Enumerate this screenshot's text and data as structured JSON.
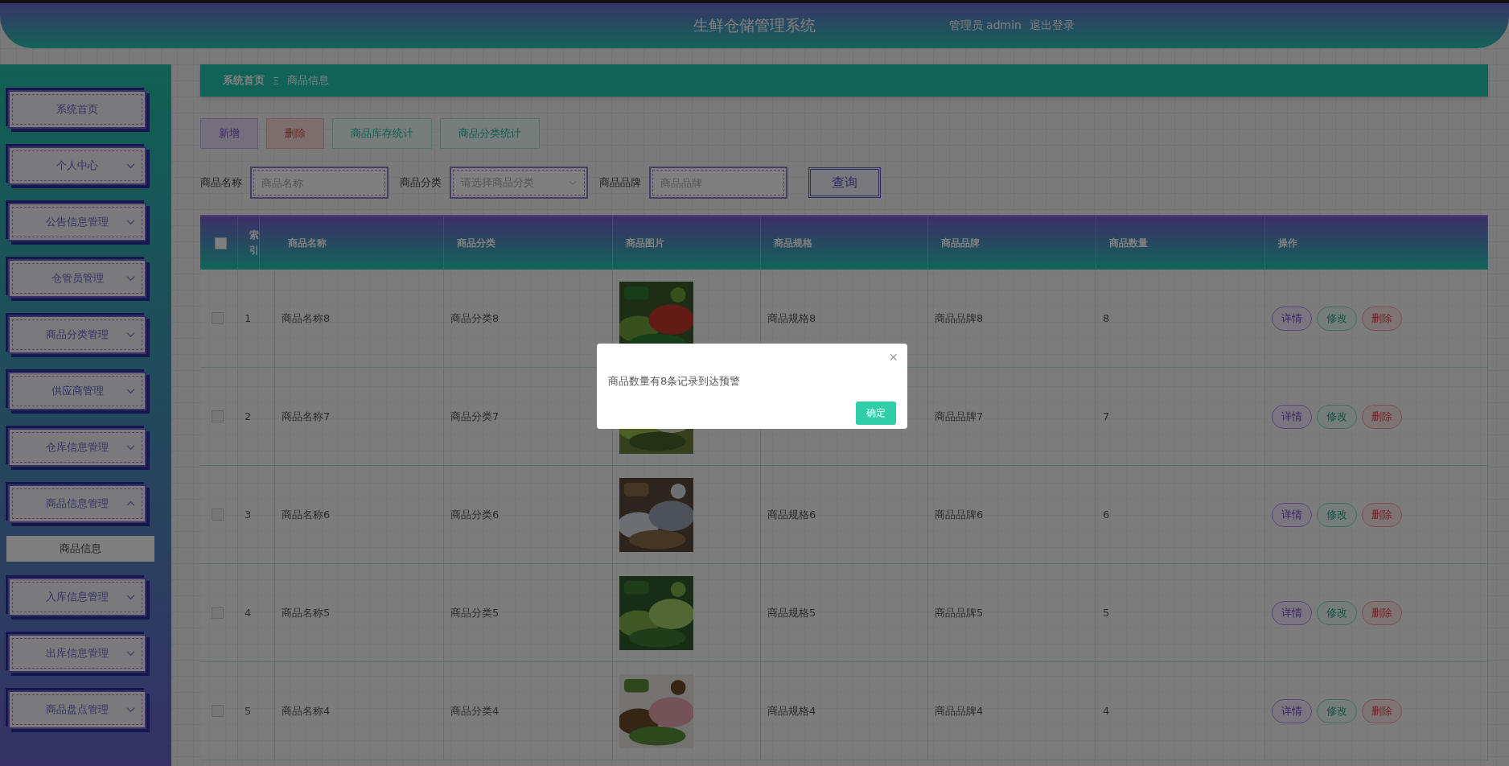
{
  "header": {
    "title": "生鲜仓储管理系统",
    "user": "管理员 admin",
    "logout": "退出登录"
  },
  "sidebar": {
    "items": [
      {
        "label": "系统首页",
        "kind": "link"
      },
      {
        "label": "个人中心",
        "kind": "group",
        "expanded": false
      },
      {
        "label": "公告信息管理",
        "kind": "group",
        "expanded": false
      },
      {
        "label": "仓管员管理",
        "kind": "group",
        "expanded": false
      },
      {
        "label": "商品分类管理",
        "kind": "group",
        "expanded": false
      },
      {
        "label": "供应商管理",
        "kind": "group",
        "expanded": false
      },
      {
        "label": "仓库信息管理",
        "kind": "group",
        "expanded": false
      },
      {
        "label": "商品信息管理",
        "kind": "group",
        "expanded": true,
        "children": [
          {
            "label": "商品信息",
            "selected": true
          }
        ]
      },
      {
        "label": "入库信息管理",
        "kind": "group",
        "expanded": false
      },
      {
        "label": "出库信息管理",
        "kind": "group",
        "expanded": false
      },
      {
        "label": "商品盘点管理",
        "kind": "group",
        "expanded": false
      }
    ]
  },
  "breadcrumb": {
    "items": [
      "系统首页",
      "商品信息"
    ],
    "separator": "Ξ"
  },
  "toolbar": [
    {
      "label": "新增",
      "kind": "add"
    },
    {
      "label": "删除",
      "kind": "delete"
    },
    {
      "label": "商品库存统计",
      "kind": "stat"
    },
    {
      "label": "商品分类统计",
      "kind": "stat"
    }
  ],
  "search": {
    "fields": [
      {
        "label": "商品名称",
        "placeholder": "商品名称",
        "kind": "input"
      },
      {
        "label": "商品分类",
        "placeholder": "请选择商品分类",
        "kind": "select"
      },
      {
        "label": "商品品牌",
        "placeholder": "商品品牌",
        "kind": "input"
      }
    ],
    "button": "查询"
  },
  "table": {
    "all_checked": false,
    "columns": [
      "索引",
      "商品名称",
      "商品分类",
      "商品图片",
      "商品规格",
      "商品品牌",
      "商品数量",
      "操作"
    ],
    "rows": [
      {
        "checked": false,
        "index": "1",
        "name": "商品名称8",
        "category": "商品分类8",
        "image": {
          "kind": "picture"
        },
        "spec": "商品规格8",
        "brand": "商品品牌8",
        "quantity": "8",
        "actions": [
          {
            "label": "详情",
            "kind": "detail"
          },
          {
            "label": "修改",
            "kind": "edit"
          },
          {
            "label": "删除",
            "kind": "delete"
          }
        ]
      },
      {
        "checked": false,
        "index": "2",
        "name": "商品名称7",
        "category": "商品分类7",
        "image": {
          "kind": "picture"
        },
        "brand": "商品品牌7",
        "quantity": "7",
        "actions": [
          {
            "label": "详情",
            "kind": "detail"
          },
          {
            "label": "修改",
            "kind": "edit"
          },
          {
            "label": "删除",
            "kind": "delete"
          }
        ]
      },
      {
        "checked": false,
        "index": "3",
        "name": "商品名称6",
        "category": "商品分类6",
        "image": {
          "kind": "picture"
        },
        "spec": "商品规格6",
        "brand": "商品品牌6",
        "quantity": "6",
        "actions": [
          {
            "label": "详情",
            "kind": "detail"
          },
          {
            "label": "修改",
            "kind": "edit"
          },
          {
            "label": "删除",
            "kind": "delete"
          }
        ]
      },
      {
        "checked": false,
        "index": "4",
        "name": "商品名称5",
        "category": "商品分类5",
        "image": {
          "kind": "picture"
        },
        "spec": "商品规格5",
        "brand": "商品品牌5",
        "quantity": "5",
        "actions": [
          {
            "label": "详情",
            "kind": "detail"
          },
          {
            "label": "修改",
            "kind": "edit"
          },
          {
            "label": "删除",
            "kind": "delete"
          }
        ]
      },
      {
        "checked": false,
        "index": "5",
        "name": "商品名称4",
        "category": "商品分类4",
        "image": {
          "kind": "picture"
        },
        "spec": "商品规格4",
        "brand": "商品品牌4",
        "quantity": "4",
        "actions": [
          {
            "label": "详情",
            "kind": "detail"
          },
          {
            "label": "修改",
            "kind": "edit"
          },
          {
            "label": "删除",
            "kind": "delete"
          }
        ]
      }
    ]
  },
  "dialog": {
    "message": "商品数量有8条记录到达预警",
    "close": "×",
    "confirm": "确定"
  }
}
